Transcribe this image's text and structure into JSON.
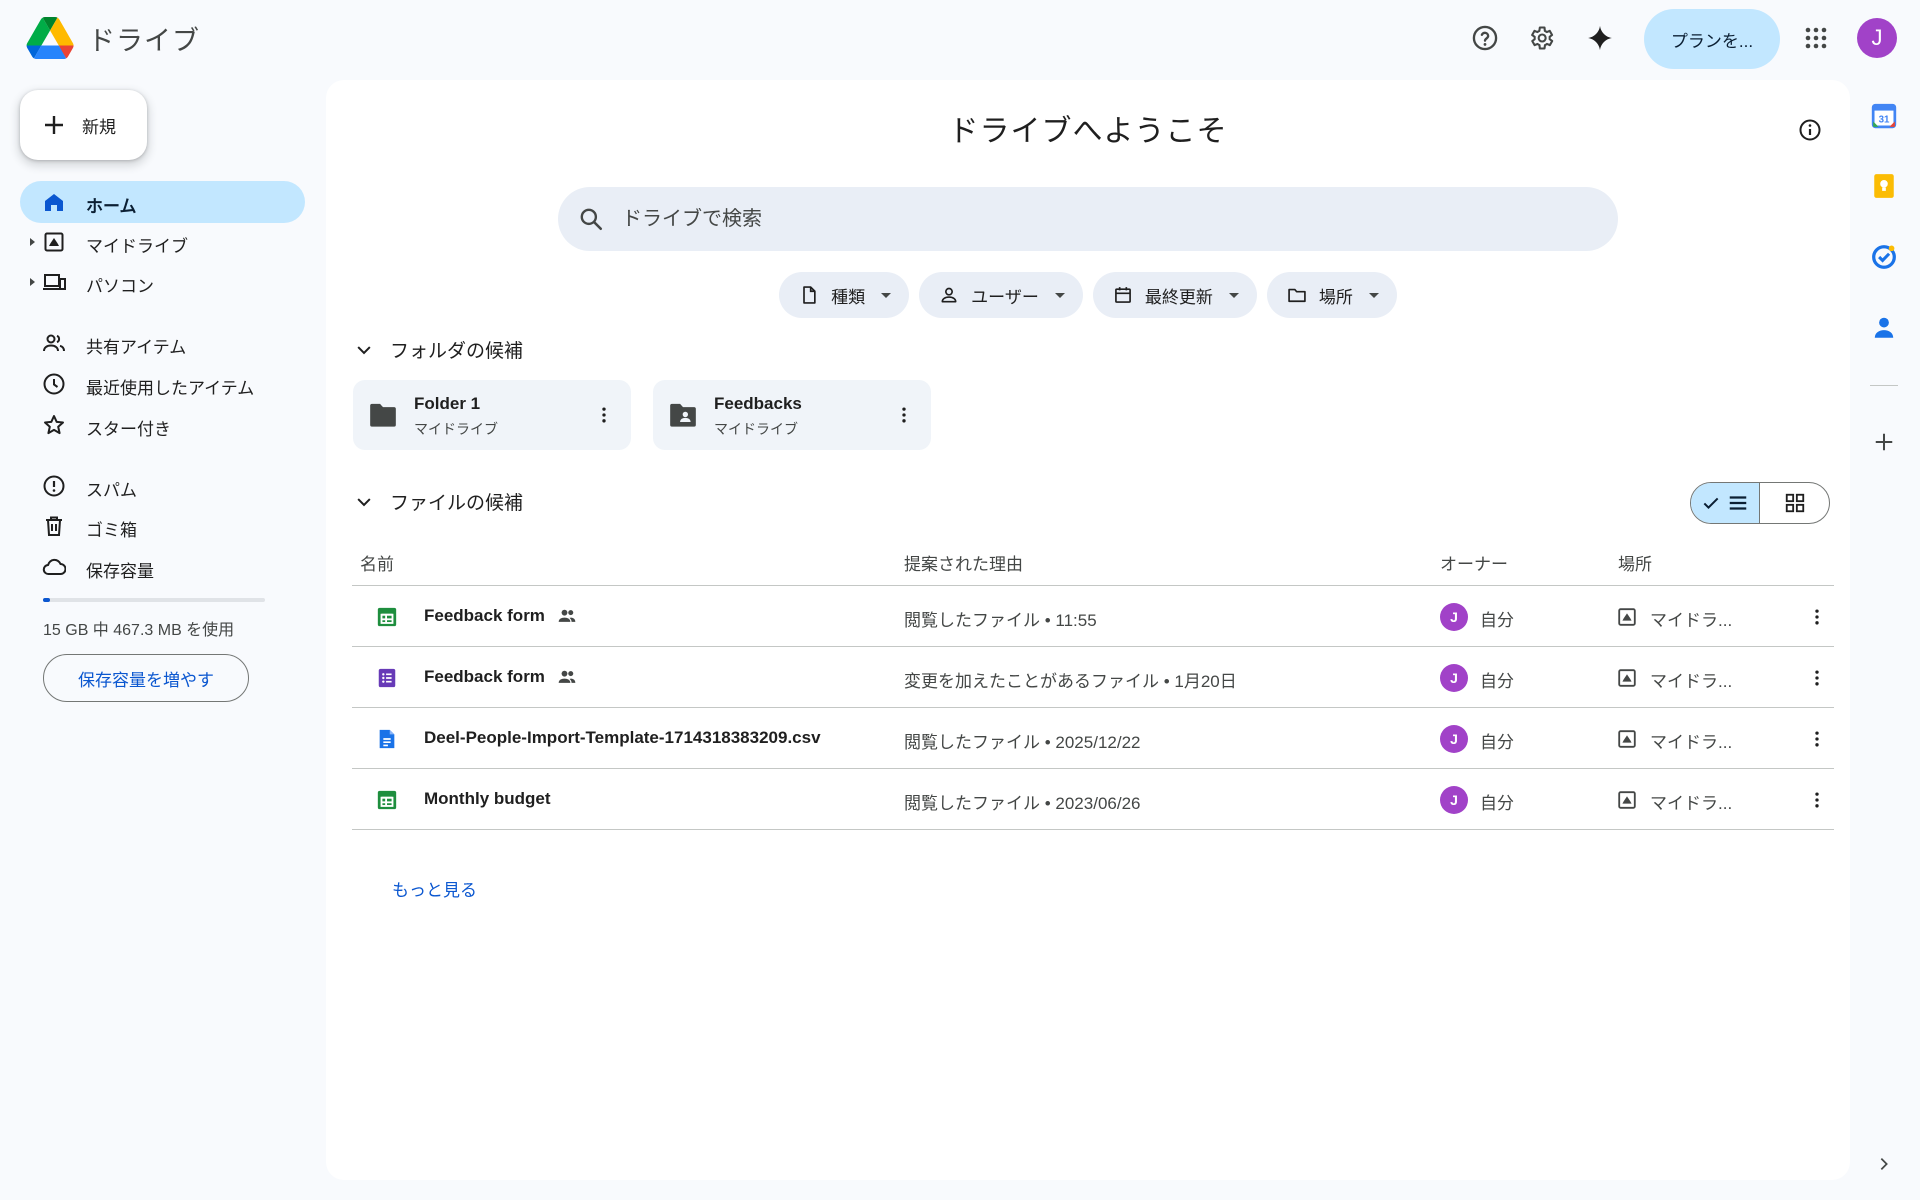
{
  "app": {
    "title": "ドライブ"
  },
  "header": {
    "plan_label": "プランを...",
    "avatar_letter": "J"
  },
  "sidebar": {
    "new_label": "新規",
    "items": [
      {
        "label": "ホーム"
      },
      {
        "label": "マイドライブ"
      },
      {
        "label": "パソコン"
      },
      {
        "label": "共有アイテム"
      },
      {
        "label": "最近使用したアイテム"
      },
      {
        "label": "スター付き"
      },
      {
        "label": "スパム"
      },
      {
        "label": "ゴミ箱"
      },
      {
        "label": "保存容量"
      }
    ],
    "storage": {
      "text": "15 GB 中 467.3 MB を使用",
      "used_fraction": 0.031,
      "button": "保存容量を増やす"
    }
  },
  "main": {
    "title": "ドライブへようこそ",
    "search_placeholder": "ドライブで検索",
    "filters": [
      {
        "label": "種類"
      },
      {
        "label": "ユーザー"
      },
      {
        "label": "最終更新"
      },
      {
        "label": "場所"
      }
    ],
    "folders_heading": "フォルダの候補",
    "folders": [
      {
        "name": "Folder 1",
        "location": "マイドライブ"
      },
      {
        "name": "Feedbacks",
        "location": "マイドライブ"
      }
    ],
    "files_heading": "ファイルの候補",
    "columns": {
      "name": "名前",
      "reason": "提案された理由",
      "owner": "オーナー",
      "location": "場所"
    },
    "files": [
      {
        "name": "Feedback form",
        "reason": "閲覧したファイル • 11:55",
        "owner": "自分",
        "owner_letter": "J",
        "location": "マイドラ...",
        "type": "sheets"
      },
      {
        "name": "Feedback form",
        "reason": "変更を加えたことがあるファイル • 1月20日",
        "owner": "自分",
        "owner_letter": "J",
        "location": "マイドラ...",
        "type": "forms"
      },
      {
        "name": "Deel-People-Import-Template-1714318383209.csv",
        "reason": "閲覧したファイル • 2025/12/22",
        "owner": "自分",
        "owner_letter": "J",
        "location": "マイドラ...",
        "type": "docs"
      },
      {
        "name": "Monthly budget",
        "reason": "閲覧したファイル • 2023/06/26",
        "owner": "自分",
        "owner_letter": "J",
        "location": "マイドラ...",
        "type": "sheets"
      }
    ],
    "see_more": "もっと見る"
  },
  "colors": {
    "accent": "#0b57d0",
    "active_bg": "#c2e7ff",
    "avatar": "#a142c8",
    "sheets": "#1e8e3e",
    "forms": "#673ab7",
    "docs": "#1a73e8"
  },
  "icons": [
    "drive-logo-icon",
    "help-icon",
    "gear-icon",
    "gemini-sparkle-icon",
    "apps-grid-icon",
    "plus-icon",
    "home-icon",
    "my-drive-icon",
    "computers-icon",
    "shared-icon",
    "clock-icon",
    "star-icon",
    "spam-icon",
    "trash-icon",
    "cloud-icon",
    "info-icon",
    "search-icon",
    "chevron-down-icon",
    "folder-icon",
    "shared-folder-icon",
    "more-vert-icon",
    "check-icon",
    "list-icon",
    "grid-icon",
    "calendar-icon",
    "keep-icon",
    "tasks-icon",
    "contacts-icon",
    "chevron-right-icon"
  ]
}
